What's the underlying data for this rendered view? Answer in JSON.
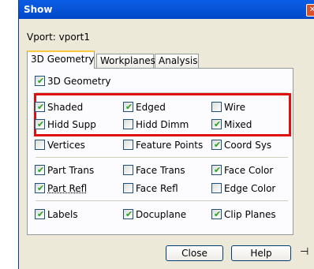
{
  "window": {
    "title": "Show",
    "close_glyph": "✕"
  },
  "vport_label": "Vport: vport1",
  "tabs": [
    {
      "label": "3D Geometry",
      "active": true
    },
    {
      "label": "Workplanes",
      "active": false
    },
    {
      "label": "Analysis",
      "active": false
    }
  ],
  "checkboxes": {
    "geometry_3d": {
      "label": "3D Geometry",
      "checked": true
    },
    "shaded": {
      "label": "Shaded",
      "checked": true
    },
    "edged": {
      "label": "Edged",
      "checked": true
    },
    "wire": {
      "label": "Wire",
      "checked": false
    },
    "hidd_supp": {
      "label": "Hidd Supp",
      "checked": true
    },
    "hidd_dimm": {
      "label": "Hidd Dimm",
      "checked": false
    },
    "mixed": {
      "label": "Mixed",
      "checked": true
    },
    "vertices": {
      "label": "Vertices",
      "checked": false
    },
    "feature_points": {
      "label": "Feature Points",
      "checked": false
    },
    "coord_sys": {
      "label": "Coord Sys",
      "checked": true
    },
    "part_trans": {
      "label": "Part Trans",
      "checked": true
    },
    "face_trans": {
      "label": "Face Trans",
      "checked": false
    },
    "face_color": {
      "label": "Face Color",
      "checked": true
    },
    "part_refl": {
      "label": "Part Refl",
      "checked": true
    },
    "face_refl": {
      "label": "Face Refl",
      "checked": false
    },
    "edge_color": {
      "label": "Edge Color",
      "checked": false
    },
    "labels": {
      "label": "Labels",
      "checked": true
    },
    "docuplane": {
      "label": "Docuplane",
      "checked": true
    },
    "clip_planes": {
      "label": "Clip Planes",
      "checked": true
    }
  },
  "buttons": {
    "close": "Close",
    "help": "Help",
    "pin_glyph": "⊣"
  },
  "colors": {
    "checkmark": "#21a121",
    "highlight": "#e01010",
    "titlebar": "#0a5ce6"
  }
}
